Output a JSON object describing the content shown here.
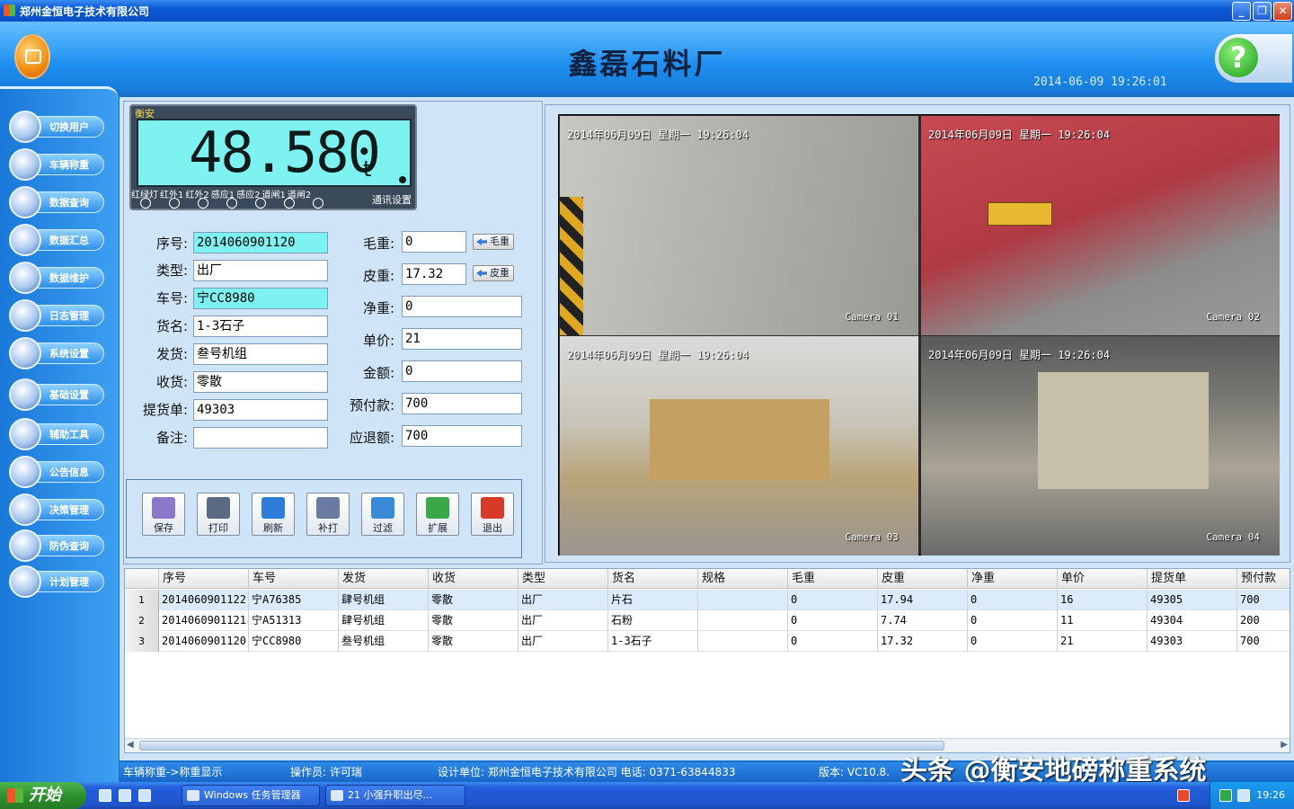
{
  "window": {
    "title": "郑州金恒电子技术有限公司",
    "min": "_",
    "max": "❐",
    "close": "✕"
  },
  "header": {
    "app_title": "鑫磊石料厂",
    "datetime": "2014-06-09 19:26:01",
    "help": "?"
  },
  "sidebar": {
    "items": [
      {
        "label": "切换用户",
        "icon": "user-switch-icon"
      },
      {
        "label": "车辆称重",
        "icon": "truck-icon"
      },
      {
        "label": "数据查询",
        "icon": "search-icon"
      },
      {
        "label": "数据汇总",
        "icon": "summary-icon"
      },
      {
        "label": "数据维护",
        "icon": "wrench-icon"
      },
      {
        "label": "日志管理",
        "icon": "calendar-icon"
      },
      {
        "label": "系统设置",
        "icon": "gear-icon"
      },
      {
        "label": "基础设置",
        "icon": "settings-icon"
      },
      {
        "label": "辅助工具",
        "icon": "tools-icon"
      },
      {
        "label": "公告信息",
        "icon": "notice-icon"
      },
      {
        "label": "决策管理",
        "icon": "decision-icon"
      },
      {
        "label": "防伪查询",
        "icon": "globe-icon"
      },
      {
        "label": "计划管理",
        "icon": "plan-icon"
      }
    ]
  },
  "scale": {
    "brand": "衡安",
    "value": "48.580",
    "unit": "t",
    "lamps": [
      "红绿灯",
      "红外1",
      "红外2",
      "感应1",
      "感应2",
      "道闸1",
      "道闸2"
    ],
    "comm_label": "通讯设置"
  },
  "form": {
    "serial": {
      "label": "序号:",
      "value": "2014060901120"
    },
    "type": {
      "label": "类型:",
      "value": "出厂"
    },
    "plate": {
      "label": "车号:",
      "value": "宁CC8980"
    },
    "goods": {
      "label": "货名:",
      "value": "1-3石子"
    },
    "sender": {
      "label": "发货:",
      "value": "叁号机组"
    },
    "receiver": {
      "label": "收货:",
      "value": "零散"
    },
    "bill": {
      "label": "提货单:",
      "value": "49303"
    },
    "remark": {
      "label": "备注:",
      "value": ""
    },
    "gross": {
      "label": "毛重:",
      "value": "0",
      "button": "毛重"
    },
    "tare": {
      "label": "皮重:",
      "value": "17.32",
      "button": "皮重"
    },
    "net": {
      "label": "净重:",
      "value": "0"
    },
    "price": {
      "label": "单价:",
      "value": "21"
    },
    "amount": {
      "label": "金额:",
      "value": "0"
    },
    "prepay": {
      "label": "预付款:",
      "value": "700"
    },
    "refund": {
      "label": "应退额:",
      "value": "700"
    }
  },
  "toolbar": {
    "buttons": [
      {
        "label": "保存",
        "icon": "save-icon",
        "color": "#8c78c8"
      },
      {
        "label": "打印",
        "icon": "print-icon",
        "color": "#5a6a80"
      },
      {
        "label": "刷新",
        "icon": "refresh-icon",
        "color": "#2e7cd8"
      },
      {
        "label": "补打",
        "icon": "reprint-icon",
        "color": "#6a7aa0"
      },
      {
        "label": "过滤",
        "icon": "filter-icon",
        "color": "#3a8ad8"
      },
      {
        "label": "扩展",
        "icon": "expand-icon",
        "color": "#3aa84a"
      },
      {
        "label": "退出",
        "icon": "exit-icon",
        "color": "#d83a2a"
      }
    ]
  },
  "cameras": [
    {
      "timestamp": "2014年06月09日  星期一  19:26:04",
      "name": "Camera 01"
    },
    {
      "timestamp": "2014年06月09日  星期一  19:26:04",
      "name": "Camera 02"
    },
    {
      "timestamp": "2014年06月09日  星期一  19:26:04",
      "name": "Camera 03"
    },
    {
      "timestamp": "2014年06月09日  星期一  19:26:04",
      "name": "Camera 04"
    }
  ],
  "table": {
    "columns": [
      "序号",
      "车号",
      "发货",
      "收货",
      "类型",
      "货名",
      "规格",
      "毛重",
      "皮重",
      "净重",
      "单价",
      "提货单",
      "预付款"
    ],
    "rows": [
      {
        "n": "1",
        "cells": [
          "2014060901122",
          "宁A76385",
          "肆号机组",
          "零散",
          "出厂",
          "片石",
          "",
          "0",
          "17.94",
          "0",
          "16",
          "49305",
          "700"
        ]
      },
      {
        "n": "2",
        "cells": [
          "2014060901121",
          "宁A51313",
          "肆号机组",
          "零散",
          "出厂",
          "石粉",
          "",
          "0",
          "7.74",
          "0",
          "11",
          "49304",
          "200"
        ]
      },
      {
        "n": "3",
        "cells": [
          "2014060901120",
          "宁CC8980",
          "叁号机组",
          "零散",
          "出厂",
          "1-3石子",
          "",
          "0",
          "17.32",
          "0",
          "21",
          "49303",
          "700"
        ]
      }
    ]
  },
  "status": {
    "path": "车辆称重->称重显示",
    "operator": "操作员: 许可瑞",
    "company": "设计单位: 郑州金恒电子技术有限公司  电话: 0371-63844833",
    "version": "版本: VC10.8."
  },
  "watermark": "头条 @衡安地磅称重系统",
  "taskbar": {
    "start": "开始",
    "tasks": [
      "Windows 任务管理器",
      "21 小强升职出尽..."
    ],
    "clock": "19:26"
  }
}
